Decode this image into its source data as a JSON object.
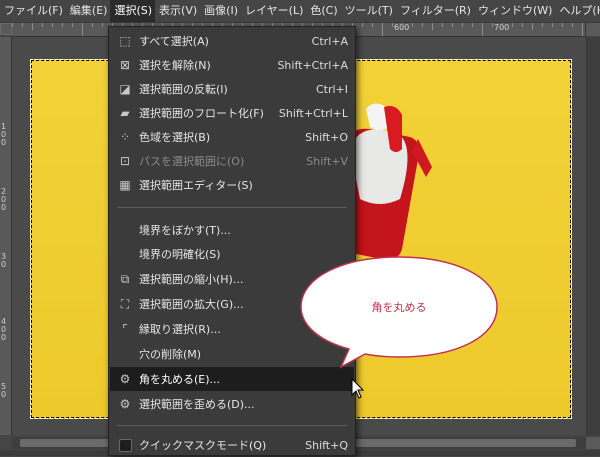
{
  "menubar": {
    "items": [
      {
        "label": "ファイル(F)"
      },
      {
        "label": "編集(E)"
      },
      {
        "label": "選択(S)"
      },
      {
        "label": "表示(V)"
      },
      {
        "label": "画像(I)"
      },
      {
        "label": "レイヤー(L)"
      },
      {
        "label": "色(C)"
      },
      {
        "label": "ツール(T)"
      },
      {
        "label": "フィルター(R)"
      },
      {
        "label": "ウィンドウ(W)"
      },
      {
        "label": "ヘルプ(H)"
      }
    ]
  },
  "ruler": {
    "h_labels": [
      "600",
      "700"
    ],
    "v_labels": [
      "1\n0\n0",
      "2\n0\n0",
      "3\n0",
      "4\n0\n0",
      "5\n0"
    ]
  },
  "select_menu": {
    "items": [
      {
        "label": "すべて選択(A)",
        "shortcut": "Ctrl+A",
        "icon": "select-all-icon",
        "disabled": false
      },
      {
        "label": "選択を解除(N)",
        "shortcut": "Shift+Ctrl+A",
        "icon": "select-none-icon",
        "disabled": false
      },
      {
        "label": "選択範囲の反転(I)",
        "shortcut": "Ctrl+I",
        "icon": "invert-icon",
        "disabled": false
      },
      {
        "label": "選択範囲のフロート化(F)",
        "shortcut": "Shift+Ctrl+L",
        "icon": "float-icon",
        "disabled": false
      },
      {
        "label": "色域を選択(B)",
        "shortcut": "Shift+O",
        "icon": "by-color-icon",
        "disabled": false
      },
      {
        "label": "パスを選択範囲に(O)",
        "shortcut": "Shift+V",
        "icon": "path-icon",
        "disabled": true
      },
      {
        "label": "選択範囲エディター(S)",
        "shortcut": "",
        "icon": "editor-icon",
        "disabled": false
      },
      {
        "label": "境界をぼかす(T)...",
        "shortcut": "",
        "icon": "",
        "disabled": false
      },
      {
        "label": "境界の明確化(S)",
        "shortcut": "",
        "icon": "",
        "disabled": false
      },
      {
        "label": "選択範囲の縮小(H)...",
        "shortcut": "",
        "icon": "shrink-icon",
        "disabled": false
      },
      {
        "label": "選択範囲の拡大(G)...",
        "shortcut": "",
        "icon": "grow-icon",
        "disabled": false
      },
      {
        "label": "縁取り選択(R)...",
        "shortcut": "",
        "icon": "border-icon",
        "disabled": false
      },
      {
        "label": "穴の削除(M)",
        "shortcut": "",
        "icon": "",
        "disabled": false
      },
      {
        "label": "角を丸める(E)...",
        "shortcut": "",
        "icon": "gear-icon",
        "disabled": false
      },
      {
        "label": "選択範囲を歪める(D)...",
        "shortcut": "",
        "icon": "gear-icon",
        "disabled": false
      },
      {
        "label": "クイックマスクモード(Q)",
        "shortcut": "Shift+Q",
        "icon": "checkbox-icon",
        "disabled": false
      }
    ]
  },
  "callout": {
    "text": "角を丸める"
  },
  "colors": {
    "accent": "#c0334e",
    "image": "#f0d031"
  }
}
